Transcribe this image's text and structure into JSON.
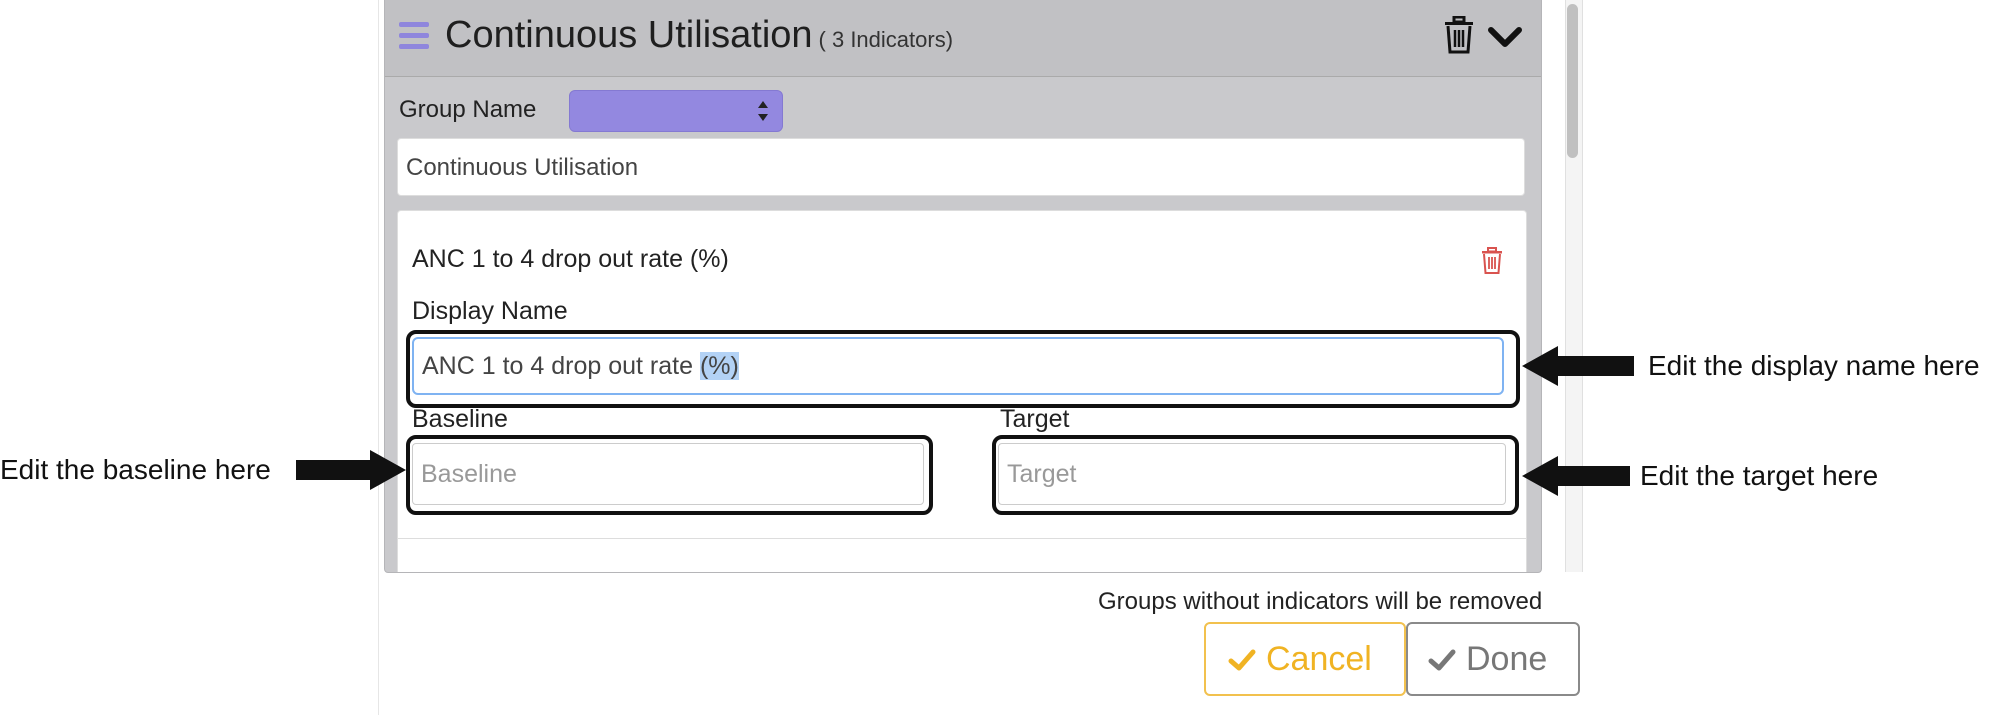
{
  "group": {
    "title": "Continuous Utilisation",
    "count": "( 3 Indicators)",
    "name_label": "Group Name",
    "name_value": "Continuous Utilisation"
  },
  "indicator": {
    "title": "ANC 1 to 4 drop out rate (%)",
    "display_name_label": "Display Name",
    "display_name_unselected": "ANC 1 to 4 drop out rate ",
    "display_name_selected": "(%)",
    "baseline_label": "Baseline",
    "baseline_placeholder": "Baseline",
    "target_label": "Target",
    "target_placeholder": "Target"
  },
  "footer": {
    "note": "Groups without indicators will be removed",
    "cancel_label": "Cancel",
    "done_label": "Done"
  },
  "annotations": {
    "display_name": "Edit the display name here",
    "baseline": "Edit the baseline here",
    "target": "Edit the target here"
  },
  "colors": {
    "accent_purple": "#9388e0",
    "cancel_yellow": "#f0b323",
    "delete_red": "#d9534f",
    "selection_blue": "#b3d2f5"
  },
  "icons": [
    "hamburger-icon",
    "trash-icon",
    "chevron-down-icon",
    "select-arrows-icon",
    "check-icon",
    "arrow-left-icon",
    "arrow-right-icon"
  ]
}
